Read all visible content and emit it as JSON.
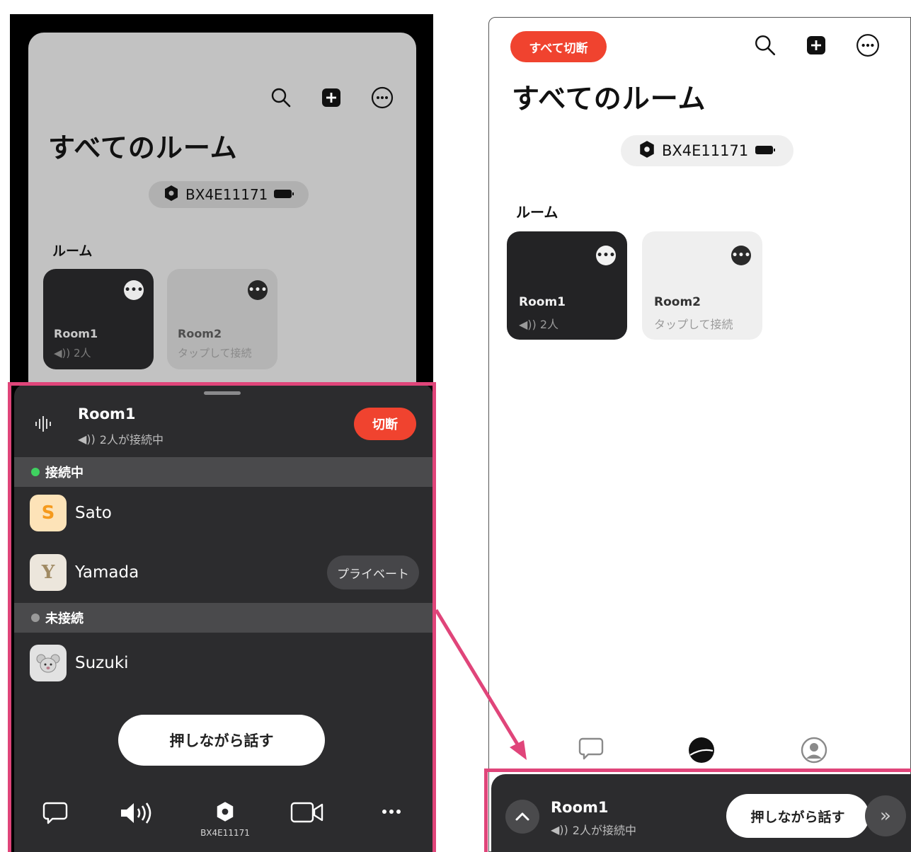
{
  "colors": {
    "accent_red": "#f0432f",
    "highlight_pink": "#e0457a",
    "connected_green": "#3fd160",
    "offline_gray": "#9a9a9a",
    "panel_dark": "#2c2c2e"
  },
  "left_screen": {
    "title": "すべてのルーム",
    "device_name": "BX4E11171",
    "rooms_label": "ルーム",
    "rooms": [
      {
        "name": "Room1",
        "subtitle": "2人",
        "icon": "speaker-icon"
      },
      {
        "name": "Room2",
        "subtitle": "タップして接続"
      }
    ],
    "now_playing": {
      "room_name": "Room1",
      "status": "2人が接続中",
      "disconnect_label": "切断"
    },
    "sections": {
      "connected_label": "接続中",
      "offline_label": "未接続"
    },
    "members_connected": [
      {
        "initial": "S",
        "name": "Sato",
        "avatar_color": "#fde3b8",
        "initial_color": "#f59a1d"
      },
      {
        "initial": "Y",
        "name": "Yamada",
        "avatar_color": "#ece6dc",
        "initial_color": "#a08a63",
        "action_label": "プライベート"
      }
    ],
    "members_offline": [
      {
        "name": "Suzuki",
        "avatar_icon": "mouse-icon"
      }
    ],
    "push_to_talk_label": "押しながら話す",
    "bottom_bar": {
      "device_label": "BX4E11171"
    }
  },
  "right_screen": {
    "disconnect_all_label": "すべて切断",
    "title": "すべてのルーム",
    "device_name": "BX4E11171",
    "rooms_label": "ルーム",
    "rooms": [
      {
        "name": "Room1",
        "subtitle": "2人"
      },
      {
        "name": "Room2",
        "subtitle": "タップして接続"
      }
    ],
    "mini_player": {
      "room_name": "Room1",
      "status": "2人が接続中",
      "push_to_talk_label": "押しながら話す",
      "next_glyph": "»"
    }
  }
}
